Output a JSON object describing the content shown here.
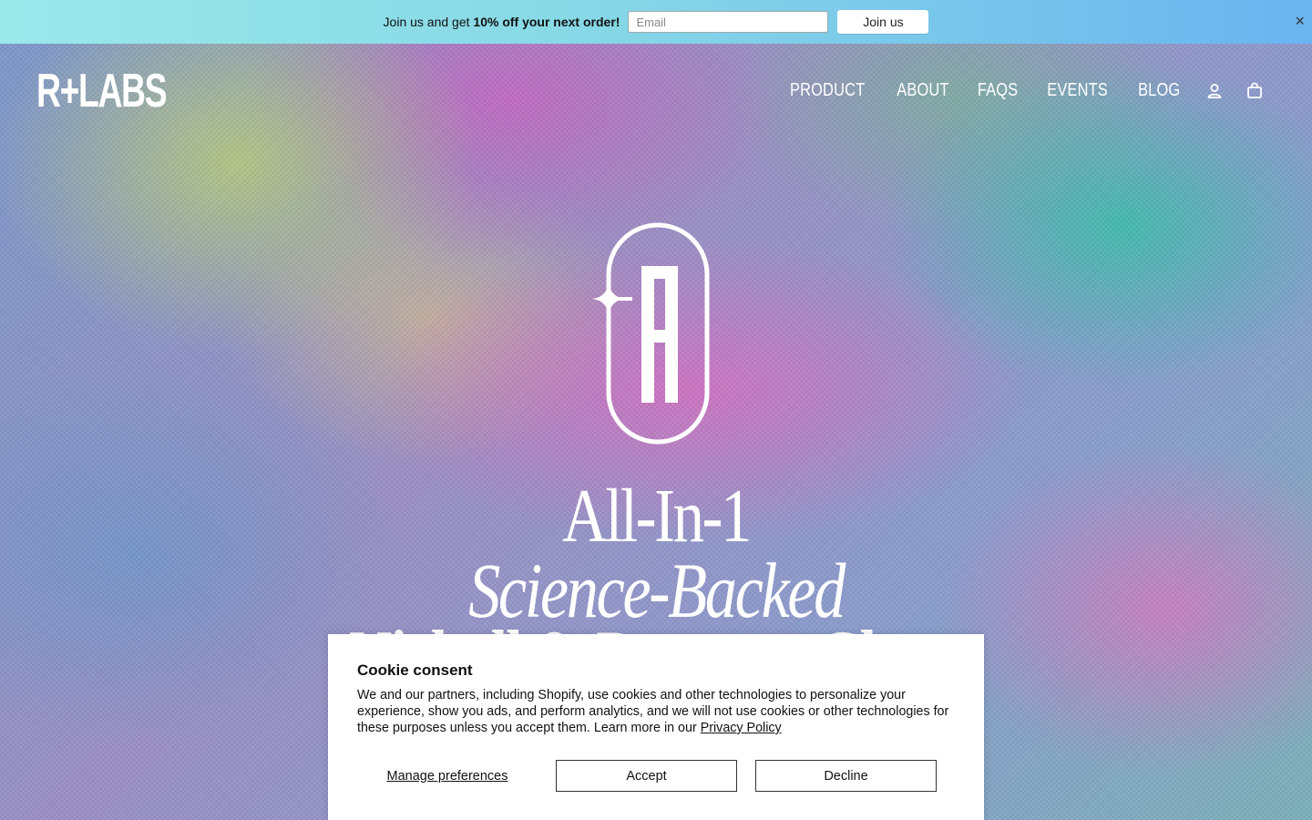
{
  "promo": {
    "text_prefix": "Join us and get ",
    "text_bold": "10% off your next order!",
    "email_placeholder": "Email",
    "button_label": "Join us",
    "close_symbol": "×"
  },
  "header": {
    "logo_text": "R+LABS",
    "nav": [
      "PRODUCT",
      "ABOUT",
      "FAQS",
      "EVENTS",
      "BLOG"
    ],
    "icons": [
      "account-icon",
      "cart-icon"
    ]
  },
  "hero": {
    "line1": "All-In-1",
    "line2": "Science-Backed",
    "line3": "Nicholl & Pressure Chart"
  },
  "cookie": {
    "title": "Cookie consent",
    "body": "We and our partners, including Shopify, use cookies and other technologies to personalize your experience, show you ads, and perform analytics, and we will not use cookies or other technologies for these purposes unless you accept them. Learn more in our ",
    "link": "Privacy Policy",
    "manage_label": "Manage preferences",
    "accept_label": "Accept",
    "decline_label": "Decline"
  }
}
